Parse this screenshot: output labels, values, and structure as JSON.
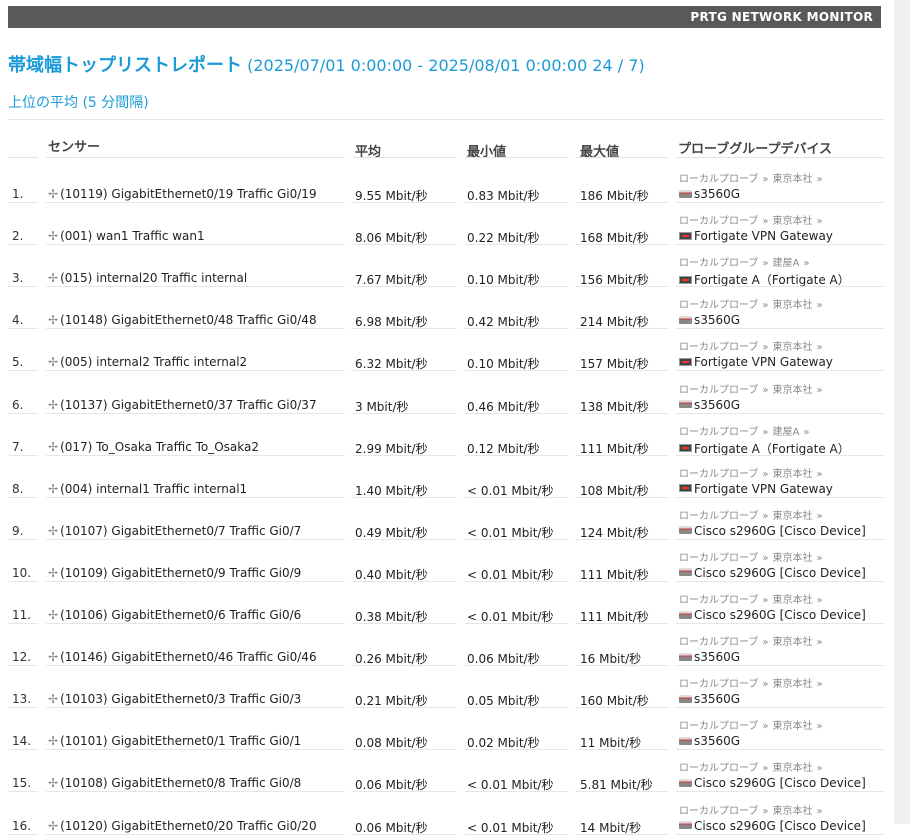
{
  "header": {
    "brand": "PRTG NETWORK MONITOR"
  },
  "report": {
    "title": "帯域幅トップリストレポート",
    "range": "(2025/07/01 0:00:00 - 2025/08/01 0:00:00 24 / 7)",
    "subtitle": "上位の平均 (5 分間隔)"
  },
  "columns": {
    "sensor": "センサー",
    "avg": "平均",
    "min": "最小値",
    "max": "最大値",
    "device": "プローブグループデバイス"
  },
  "path_separator": "»",
  "rows": [
    {
      "num": "1.",
      "sensor": "(10119) GigabitEthernet0/19 Traffic Gi0/19",
      "avg": "9.55 Mbit/秒",
      "min": "0.83 Mbit/秒",
      "max": "186 Mbit/秒",
      "probe": "ローカルプローブ",
      "group": "東京本社",
      "device": "s3560G",
      "device_icon": "switch"
    },
    {
      "num": "2.",
      "sensor": "(001) wan1 Traffic wan1",
      "avg": "8.06 Mbit/秒",
      "min": "0.22 Mbit/秒",
      "max": "168 Mbit/秒",
      "probe": "ローカルプローブ",
      "group": "東京本社",
      "device": "Fortigate VPN Gateway",
      "device_icon": "firewall"
    },
    {
      "num": "3.",
      "sensor": "(015) internal20 Traffic internal",
      "avg": "7.67 Mbit/秒",
      "min": "0.10 Mbit/秒",
      "max": "156 Mbit/秒",
      "probe": "ローカルプローブ",
      "group": "建屋A",
      "device": "Fortigate A（Fortigate A）",
      "device_icon": "firewall"
    },
    {
      "num": "4.",
      "sensor": "(10148) GigabitEthernet0/48 Traffic Gi0/48",
      "avg": "6.98 Mbit/秒",
      "min": "0.42 Mbit/秒",
      "max": "214 Mbit/秒",
      "probe": "ローカルプローブ",
      "group": "東京本社",
      "device": "s3560G",
      "device_icon": "switch"
    },
    {
      "num": "5.",
      "sensor": "(005) internal2 Traffic internal2",
      "avg": "6.32 Mbit/秒",
      "min": "0.10 Mbit/秒",
      "max": "157 Mbit/秒",
      "probe": "ローカルプローブ",
      "group": "東京本社",
      "device": "Fortigate VPN Gateway",
      "device_icon": "firewall"
    },
    {
      "num": "6.",
      "sensor": "(10137) GigabitEthernet0/37 Traffic Gi0/37",
      "avg": "3 Mbit/秒",
      "min": "0.46 Mbit/秒",
      "max": "138 Mbit/秒",
      "probe": "ローカルプローブ",
      "group": "東京本社",
      "device": "s3560G",
      "device_icon": "switch"
    },
    {
      "num": "7.",
      "sensor": "(017) To_Osaka Traffic To_Osaka2",
      "avg": "2.99 Mbit/秒",
      "min": "0.12 Mbit/秒",
      "max": "111 Mbit/秒",
      "probe": "ローカルプローブ",
      "group": "建屋A",
      "device": "Fortigate A（Fortigate A）",
      "device_icon": "firewall"
    },
    {
      "num": "8.",
      "sensor": "(004) internal1 Traffic internal1",
      "avg": "1.40 Mbit/秒",
      "min": "< 0.01 Mbit/秒",
      "max": "108 Mbit/秒",
      "probe": "ローカルプローブ",
      "group": "東京本社",
      "device": "Fortigate VPN Gateway",
      "device_icon": "firewall"
    },
    {
      "num": "9.",
      "sensor": "(10107) GigabitEthernet0/7 Traffic Gi0/7",
      "avg": "0.49 Mbit/秒",
      "min": "< 0.01 Mbit/秒",
      "max": "124 Mbit/秒",
      "probe": "ローカルプローブ",
      "group": "東京本社",
      "device": "Cisco s2960G [Cisco Device]",
      "device_icon": "switch"
    },
    {
      "num": "10.",
      "sensor": "(10109) GigabitEthernet0/9 Traffic Gi0/9",
      "avg": "0.40 Mbit/秒",
      "min": "< 0.01 Mbit/秒",
      "max": "111 Mbit/秒",
      "probe": "ローカルプローブ",
      "group": "東京本社",
      "device": "Cisco s2960G [Cisco Device]",
      "device_icon": "switch"
    },
    {
      "num": "11.",
      "sensor": "(10106) GigabitEthernet0/6 Traffic Gi0/6",
      "avg": "0.38 Mbit/秒",
      "min": "< 0.01 Mbit/秒",
      "max": "111 Mbit/秒",
      "probe": "ローカルプローブ",
      "group": "東京本社",
      "device": "Cisco s2960G [Cisco Device]",
      "device_icon": "switch"
    },
    {
      "num": "12.",
      "sensor": "(10146) GigabitEthernet0/46 Traffic Gi0/46",
      "avg": "0.26 Mbit/秒",
      "min": "0.06 Mbit/秒",
      "max": "16 Mbit/秒",
      "probe": "ローカルプローブ",
      "group": "東京本社",
      "device": "s3560G",
      "device_icon": "switch"
    },
    {
      "num": "13.",
      "sensor": "(10103) GigabitEthernet0/3 Traffic Gi0/3",
      "avg": "0.21 Mbit/秒",
      "min": "0.05 Mbit/秒",
      "max": "160 Mbit/秒",
      "probe": "ローカルプローブ",
      "group": "東京本社",
      "device": "s3560G",
      "device_icon": "switch"
    },
    {
      "num": "14.",
      "sensor": "(10101) GigabitEthernet0/1 Traffic Gi0/1",
      "avg": "0.08 Mbit/秒",
      "min": "0.02 Mbit/秒",
      "max": "11 Mbit/秒",
      "probe": "ローカルプローブ",
      "group": "東京本社",
      "device": "s3560G",
      "device_icon": "switch"
    },
    {
      "num": "15.",
      "sensor": "(10108) GigabitEthernet0/8 Traffic Gi0/8",
      "avg": "0.06 Mbit/秒",
      "min": "< 0.01 Mbit/秒",
      "max": "5.81 Mbit/秒",
      "probe": "ローカルプローブ",
      "group": "東京本社",
      "device": "Cisco s2960G [Cisco Device]",
      "device_icon": "switch"
    },
    {
      "num": "16.",
      "sensor": "(10120) GigabitEthernet0/20 Traffic Gi0/20",
      "avg": "0.06 Mbit/秒",
      "min": "< 0.01 Mbit/秒",
      "max": "14 Mbit/秒",
      "probe": "ローカルプローブ",
      "group": "東京本社",
      "device": "Cisco s2960G [Cisco Device]",
      "device_icon": "switch"
    }
  ]
}
